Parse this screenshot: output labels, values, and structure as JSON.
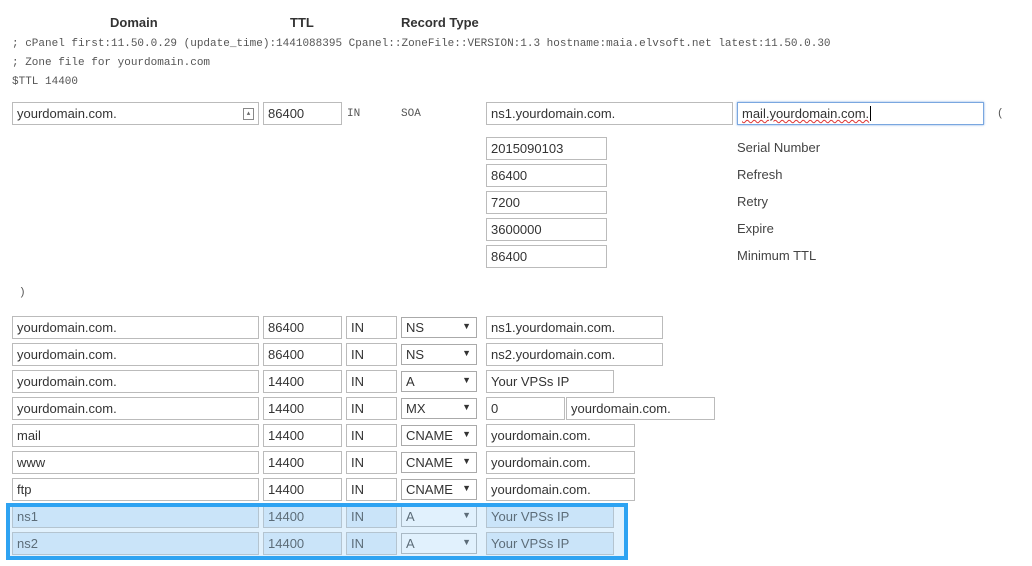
{
  "headers": {
    "domain": "Domain",
    "ttl": "TTL",
    "record_type": "Record Type"
  },
  "comments": [
    "; cPanel first:11.50.0.29 (update_time):1441088395 Cpanel::ZoneFile::VERSION:1.3 hostname:maia.elvsoft.net latest:11.50.0.30",
    "; Zone file for yourdomain.com",
    "$TTL 14400"
  ],
  "soa": {
    "domain": "yourdomain.com.",
    "ttl": "86400",
    "class": "IN",
    "type": "SOA",
    "primary_ns": "ns1.yourdomain.com.",
    "email": "mail.yourdomain.com.",
    "open_paren": "(",
    "close_paren": ")",
    "fields": [
      {
        "value": "2015090103",
        "label": "Serial Number"
      },
      {
        "value": "86400",
        "label": "Refresh"
      },
      {
        "value": "7200",
        "label": "Retry"
      },
      {
        "value": "3600000",
        "label": "Expire"
      },
      {
        "value": "86400",
        "label": "Minimum TTL"
      }
    ]
  },
  "records": [
    {
      "domain": "yourdomain.com.",
      "ttl": "86400",
      "class": "IN",
      "type": "NS",
      "data": [
        "ns1.yourdomain.com."
      ]
    },
    {
      "domain": "yourdomain.com.",
      "ttl": "86400",
      "class": "IN",
      "type": "NS",
      "data": [
        "ns2.yourdomain.com."
      ]
    },
    {
      "domain": "yourdomain.com.",
      "ttl": "14400",
      "class": "IN",
      "type": "A",
      "data": [
        "Your VPSs IP"
      ]
    },
    {
      "domain": "yourdomain.com.",
      "ttl": "14400",
      "class": "IN",
      "type": "MX",
      "data": [
        "0",
        "yourdomain.com."
      ]
    },
    {
      "domain": "mail",
      "ttl": "14400",
      "class": "IN",
      "type": "CNAME",
      "data": [
        "yourdomain.com."
      ]
    },
    {
      "domain": "www",
      "ttl": "14400",
      "class": "IN",
      "type": "CNAME",
      "data": [
        "yourdomain.com."
      ]
    },
    {
      "domain": "ftp",
      "ttl": "14400",
      "class": "IN",
      "type": "CNAME",
      "data": [
        "yourdomain.com."
      ]
    },
    {
      "domain": "ns1",
      "ttl": "14400",
      "class": "IN",
      "type": "A",
      "data": [
        "Your VPSs IP"
      ],
      "highlighted": true
    },
    {
      "domain": "ns2",
      "ttl": "14400",
      "class": "IN",
      "type": "A",
      "data": [
        "Your VPSs IP"
      ],
      "highlighted": true
    }
  ],
  "highlight_color": "#2ea3f2"
}
